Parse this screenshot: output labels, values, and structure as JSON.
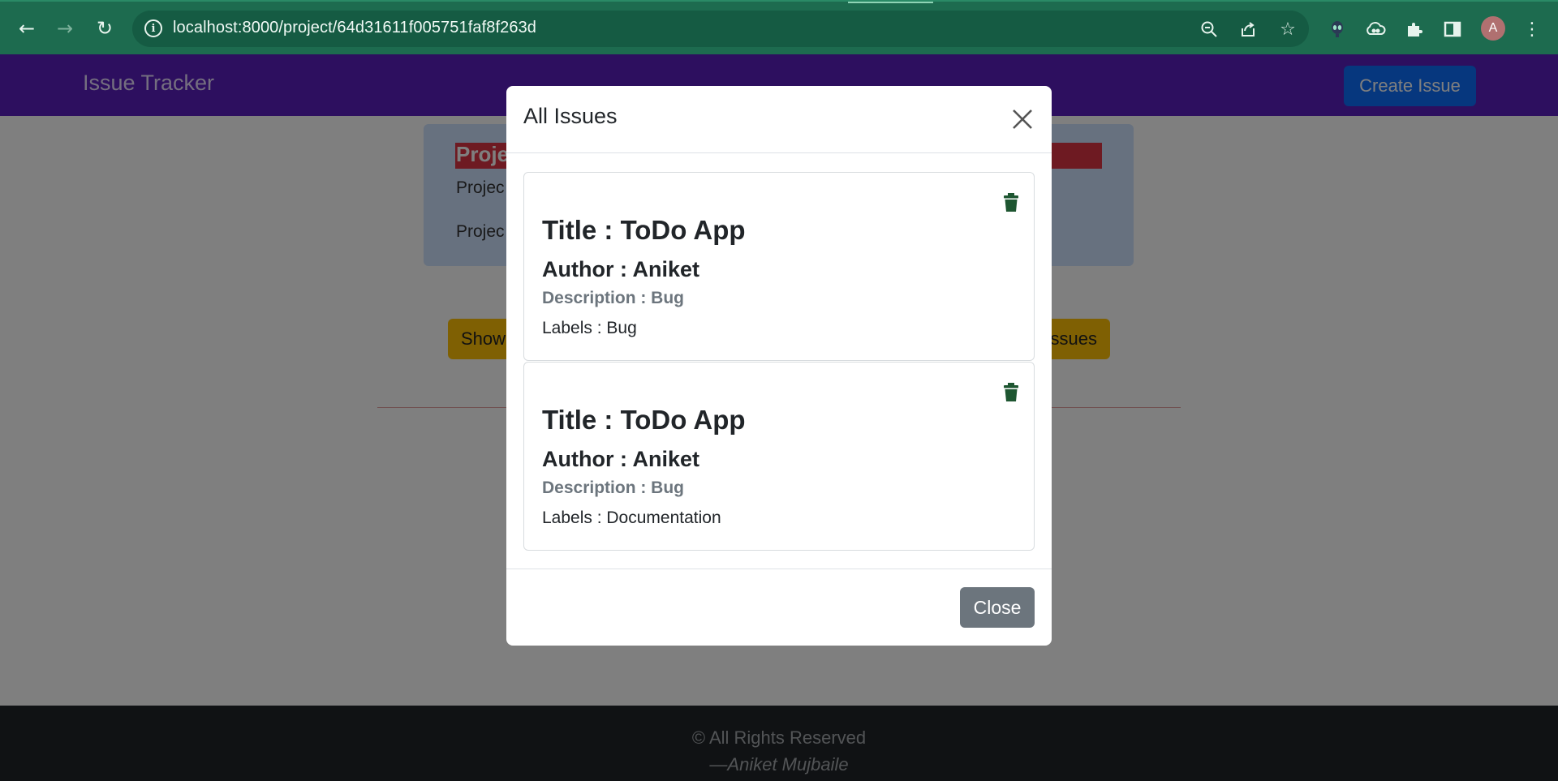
{
  "browser": {
    "url": "localhost:8000/project/64d31611f005751faf8f263d",
    "avatar_letter": "A"
  },
  "navbar": {
    "brand": "Issue Tracker",
    "create_issue_label": "Create Issue",
    "color": "#5b1fbe"
  },
  "project": {
    "title_visible": "Proje",
    "line1_visible": "Projec",
    "line2_visible": "Projec"
  },
  "buttons": {
    "show_visible": "Show",
    "issues_visible": "ssues"
  },
  "footer": {
    "line1": "© All Rights Reserved",
    "line2": "—Aniket Mujbaile"
  },
  "modal": {
    "title": "All Issues",
    "close_label": "Close",
    "issues": [
      {
        "title": "Title : ToDo App",
        "author": "Author : Aniket",
        "description": "Description : Bug",
        "labels": "Labels : Bug"
      },
      {
        "title": "Title : ToDo App",
        "author": "Author : Aniket",
        "description": "Description : Bug",
        "labels": "Labels : Documentation"
      }
    ]
  },
  "colors": {
    "trash_icon": "#1e5631",
    "close_button": "#6c757d",
    "description_text": "#6c757d"
  }
}
